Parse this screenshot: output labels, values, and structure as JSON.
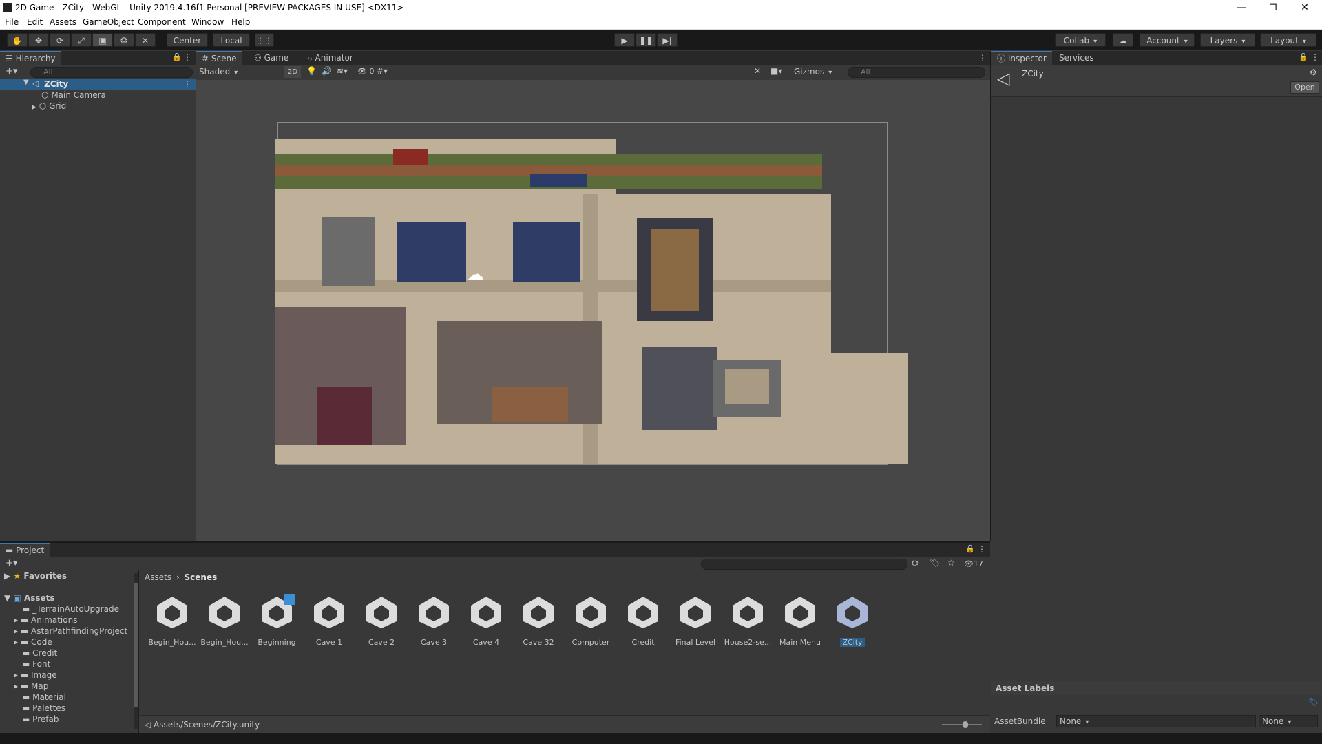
{
  "window": {
    "title": "2D Game - ZCity - WebGL - Unity 2019.4.16f1 Personal [PREVIEW PACKAGES IN USE] <DX11>",
    "controls": {
      "minimize": "—",
      "maximize": "❐",
      "close": "✕"
    }
  },
  "menu": [
    "File",
    "Edit",
    "Assets",
    "GameObject",
    "Component",
    "Window",
    "Help"
  ],
  "toolbar": {
    "tools": [
      "hand-icon",
      "move-icon",
      "rotate-icon",
      "scale-icon",
      "rect-tool-icon",
      "transform-icon",
      "custom-tool-icon"
    ],
    "pivot_mode": "Center",
    "pivot_rotation": "Local",
    "collab": "Collab",
    "account": "Account",
    "layers": "Layers",
    "layout": "Layout"
  },
  "hierarchy": {
    "tab": "Hierarchy",
    "search_placeholder": "All",
    "scene": "ZCity",
    "children": [
      "Main Camera",
      "Grid"
    ]
  },
  "scene_view": {
    "tabs": [
      "Scene",
      "Game",
      "Animator"
    ],
    "shading": "Shaded",
    "mode_2d": "2D",
    "hidden_count": "0",
    "gizmos": "Gizmos",
    "search_placeholder": "All"
  },
  "inspector": {
    "tabs": [
      "Inspector",
      "Services"
    ],
    "object_name": "ZCity",
    "open_button": "Open",
    "asset_labels": "Asset Labels",
    "asset_bundle_label": "AssetBundle",
    "asset_bundle_value": "None",
    "asset_bundle_variant": "None"
  },
  "project": {
    "tab": "Project",
    "count": "17",
    "favorites": "Favorites",
    "assets_root": "Assets",
    "folders": [
      "_TerrainAutoUpgrade",
      "Animations",
      "AstarPathfindingProject",
      "Code",
      "Credit",
      "Font",
      "Image",
      "Map",
      "Material",
      "Palettes",
      "Prefab"
    ],
    "breadcrumb": [
      "Assets",
      "Scenes"
    ],
    "scenes": [
      "Begin_Hou...",
      "Begin_Hou...",
      "Beginning",
      "Cave 1",
      "Cave 2",
      "Cave 3",
      "Cave 4",
      "Cave 32",
      "Computer",
      "Credit",
      "Final Level",
      "House2-se...",
      "Main Menu",
      "ZCity"
    ],
    "selected_path": "Assets/Scenes/ZCity.unity"
  }
}
